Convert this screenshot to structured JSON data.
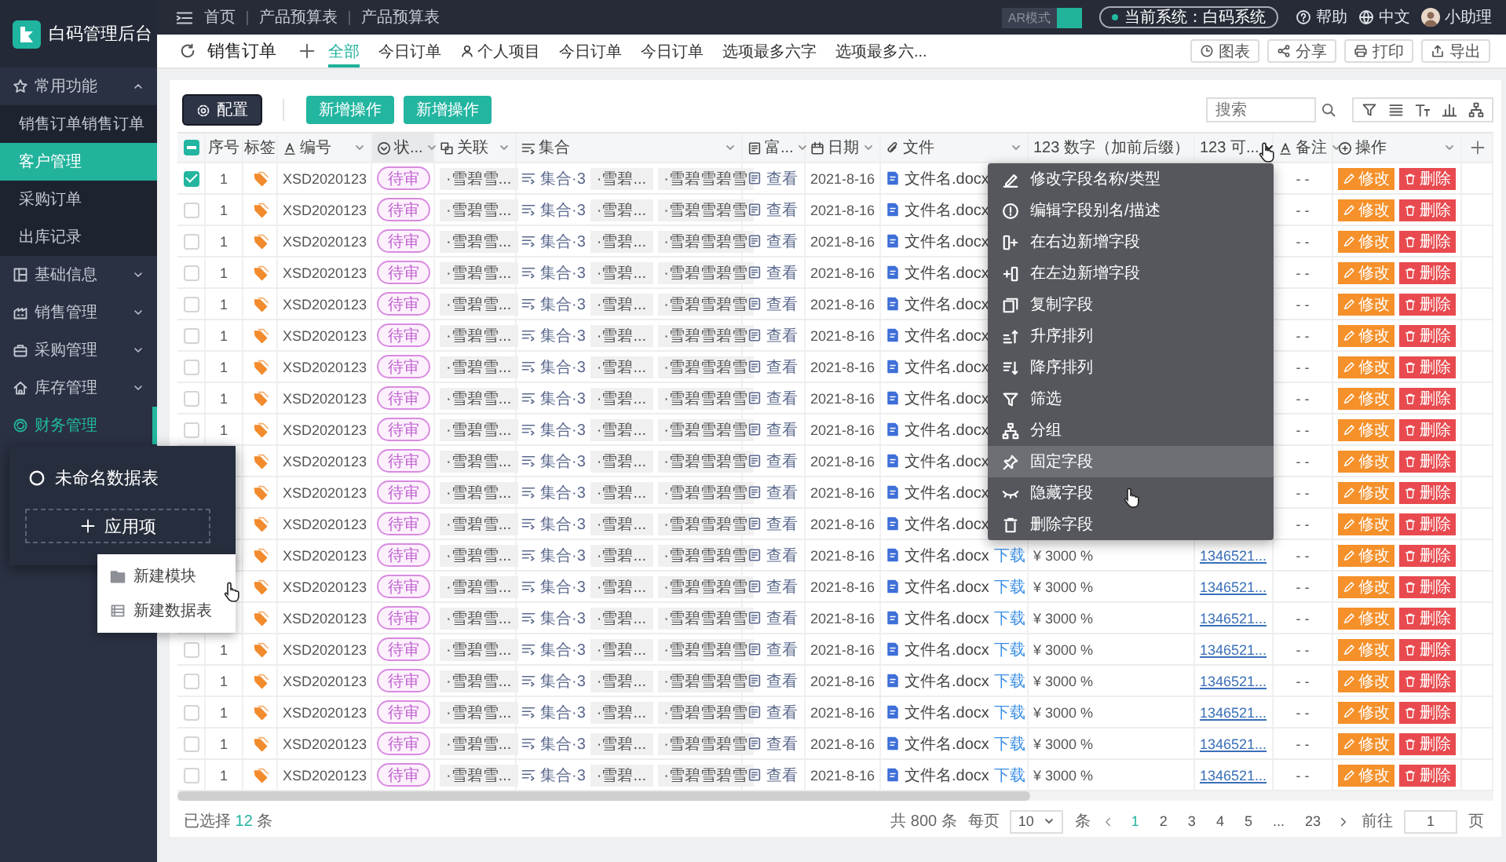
{
  "app": {
    "title": "白码管理后台"
  },
  "sidebar": {
    "items": [
      {
        "label": "常用功能",
        "selected": false,
        "expanded": true,
        "children": [
          {
            "label": "销售订单销售订单",
            "selected": false
          },
          {
            "label": "客户管理",
            "selected": true
          },
          {
            "label": "采购订单",
            "selected": false
          },
          {
            "label": "出库记录",
            "selected": false
          }
        ]
      },
      {
        "label": "基础信息",
        "selected": false,
        "expanded": false
      },
      {
        "label": "销售管理",
        "selected": false,
        "expanded": false
      },
      {
        "label": "采购管理",
        "selected": false,
        "expanded": false
      },
      {
        "label": "库存管理",
        "selected": false,
        "expanded": false
      },
      {
        "label": "财务管理",
        "selected": true
      }
    ]
  },
  "sidebar_popup": {
    "title": "未命名数据表",
    "add_button": "应用项",
    "menu": [
      {
        "label": "新建模块"
      },
      {
        "label": "新建数据表"
      }
    ]
  },
  "topbar": {
    "breadcrumbs": [
      "首页",
      "产品预算表",
      "产品预算表"
    ],
    "mode": {
      "label": "AR模式",
      "on": true
    },
    "system": "当前系统：白码系统",
    "help": "帮助",
    "language": "中文",
    "user": "小助理"
  },
  "page": {
    "title": "销售订单",
    "tabs": [
      {
        "label": "全部",
        "kind": "text",
        "selected": true
      },
      {
        "label": "今日订单",
        "kind": "text",
        "selected": false
      },
      {
        "label": "个人项目",
        "kind": "user",
        "selected": false
      },
      {
        "label": "今日订单",
        "kind": "text",
        "selected": false
      },
      {
        "label": "今日订单",
        "kind": "text",
        "selected": false
      },
      {
        "label": "选项最多六字",
        "kind": "text",
        "selected": false
      },
      {
        "label": "选项最多六...",
        "kind": "text",
        "selected": false
      }
    ],
    "actions": [
      "图表",
      "分享",
      "打印",
      "导出"
    ]
  },
  "toolbar": {
    "buttons": [
      {
        "label": "配置",
        "kind": "config"
      },
      {
        "label": "新增操作",
        "kind": "primary"
      },
      {
        "label": "新增操作",
        "kind": "primary"
      }
    ],
    "search": {
      "placeholder": "搜索"
    }
  },
  "table": {
    "select_all": {
      "indeterminate": true
    },
    "columns": [
      {
        "label": "序号",
        "kind": "seq",
        "highlighted": false
      },
      {
        "label": "标签",
        "kind": "tag",
        "highlighted": false
      },
      {
        "label": "编号",
        "kind": "code",
        "highlighted": false
      },
      {
        "label": "状...",
        "kind": "status",
        "highlighted": true
      },
      {
        "label": "关联",
        "kind": "link",
        "highlighted": false
      },
      {
        "label": "集合",
        "kind": "set",
        "highlighted": false
      },
      {
        "label": "富...",
        "kind": "rich",
        "highlighted": false
      },
      {
        "label": "日期",
        "kind": "date",
        "highlighted": false
      },
      {
        "label": "文件",
        "kind": "file",
        "highlighted": false
      },
      {
        "label": "123 数字（加前后缀）",
        "kind": "number",
        "highlighted": false
      },
      {
        "label": "123 可...",
        "kind": "number2",
        "highlighted": false
      },
      {
        "label": "备注",
        "kind": "note",
        "highlighted": false
      },
      {
        "label": "操作",
        "kind": "ops",
        "highlighted": false
      }
    ],
    "rows": [
      {
        "checked": true,
        "seq": "1",
        "code": "XSD2020123",
        "status": "待审",
        "link": "·雪碧雪...",
        "set": "集合·3",
        "set_items": [
          "·雪碧...",
          "·雪碧雪碧雪"
        ],
        "rich": "查看",
        "date": "2021-8-16",
        "file": "文件名.docx",
        "note": "- -",
        "actions": [
          {
            "label": "修改",
            "kind": "edit"
          },
          {
            "label": "删除",
            "kind": "delete"
          }
        ]
      },
      {
        "checked": false,
        "seq": "1",
        "code": "XSD2020123",
        "status": "待审",
        "link": "·雪碧雪...",
        "set": "集合·3",
        "set_items": [
          "·雪碧...",
          "·雪碧雪碧雪"
        ],
        "rich": "查看",
        "date": "2021-8-16",
        "file": "文件名.docx",
        "note": "- -",
        "actions": [
          {
            "label": "修改",
            "kind": "edit"
          },
          {
            "label": "删除",
            "kind": "delete"
          }
        ]
      },
      {
        "checked": false,
        "seq": "1",
        "code": "XSD2020123",
        "status": "待审",
        "link": "·雪碧雪...",
        "set": "集合·3",
        "set_items": [
          "·雪碧...",
          "·雪碧雪碧雪"
        ],
        "rich": "查看",
        "date": "2021-8-16",
        "file": "文件名.docx",
        "note": "- -",
        "actions": [
          {
            "label": "修改",
            "kind": "edit"
          },
          {
            "label": "删除",
            "kind": "delete"
          }
        ]
      },
      {
        "checked": false,
        "seq": "1",
        "code": "XSD2020123",
        "status": "待审",
        "link": "·雪碧雪...",
        "set": "集合·3",
        "set_items": [
          "·雪碧...",
          "·雪碧雪碧雪"
        ],
        "rich": "查看",
        "date": "2021-8-16",
        "file": "文件名.docx",
        "note": "- -",
        "actions": [
          {
            "label": "修改",
            "kind": "edit"
          },
          {
            "label": "删除",
            "kind": "delete"
          }
        ]
      },
      {
        "checked": false,
        "seq": "1",
        "code": "XSD2020123",
        "status": "待审",
        "link": "·雪碧雪...",
        "set": "集合·3",
        "set_items": [
          "·雪碧...",
          "·雪碧雪碧雪"
        ],
        "rich": "查看",
        "date": "2021-8-16",
        "file": "文件名.docx",
        "note": "- -",
        "actions": [
          {
            "label": "修改",
            "kind": "edit"
          },
          {
            "label": "删除",
            "kind": "delete"
          }
        ]
      },
      {
        "checked": false,
        "seq": "1",
        "code": "XSD2020123",
        "status": "待审",
        "link": "·雪碧雪...",
        "set": "集合·3",
        "set_items": [
          "·雪碧...",
          "·雪碧雪碧雪"
        ],
        "rich": "查看",
        "date": "2021-8-16",
        "file": "文件名.docx",
        "note": "- -",
        "actions": [
          {
            "label": "修改",
            "kind": "edit"
          },
          {
            "label": "删除",
            "kind": "delete"
          }
        ]
      },
      {
        "checked": false,
        "seq": "1",
        "code": "XSD2020123",
        "status": "待审",
        "link": "·雪碧雪...",
        "set": "集合·3",
        "set_items": [
          "·雪碧...",
          "·雪碧雪碧雪"
        ],
        "rich": "查看",
        "date": "2021-8-16",
        "file": "文件名.docx",
        "note": "- -",
        "actions": [
          {
            "label": "修改",
            "kind": "edit"
          },
          {
            "label": "删除",
            "kind": "delete"
          }
        ]
      },
      {
        "checked": false,
        "seq": "1",
        "code": "XSD2020123",
        "status": "待审",
        "link": "·雪碧雪...",
        "set": "集合·3",
        "set_items": [
          "·雪碧...",
          "·雪碧雪碧雪"
        ],
        "rich": "查看",
        "date": "2021-8-16",
        "file": "文件名.docx",
        "note": "- -",
        "actions": [
          {
            "label": "修改",
            "kind": "edit"
          },
          {
            "label": "删除",
            "kind": "delete"
          }
        ]
      },
      {
        "checked": false,
        "seq": "1",
        "code": "XSD2020123",
        "status": "待审",
        "link": "·雪碧雪...",
        "set": "集合·3",
        "set_items": [
          "·雪碧...",
          "·雪碧雪碧雪"
        ],
        "rich": "查看",
        "date": "2021-8-16",
        "file": "文件名.docx",
        "note": "- -",
        "actions": [
          {
            "label": "修改",
            "kind": "edit"
          },
          {
            "label": "删除",
            "kind": "delete"
          }
        ]
      },
      {
        "code": "XSD2020123",
        "status": "待审",
        "link": "·雪碧雪...",
        "set": "集合·3",
        "set_items": [
          "·雪碧...",
          "·雪碧雪碧雪"
        ],
        "rich": "查看",
        "date": "2021-8-16",
        "file": "文件名.docx",
        "note": "- -",
        "actions": [
          {
            "label": "修改",
            "kind": "edit"
          },
          {
            "label": "删除",
            "kind": "delete"
          }
        ]
      },
      {
        "code": "XSD2020123",
        "status": "待审",
        "link": "·雪碧雪...",
        "set": "集合·3",
        "set_items": [
          "·雪碧...",
          "·雪碧雪碧雪"
        ],
        "rich": "查看",
        "date": "2021-8-16",
        "file": "文件名.docx",
        "note": "- -",
        "actions": [
          {
            "label": "修改",
            "kind": "edit"
          },
          {
            "label": "删除",
            "kind": "delete"
          }
        ]
      },
      {
        "code": "XSD2020123",
        "status": "待审",
        "link": "·雪碧雪...",
        "set": "集合·3",
        "set_items": [
          "·雪碧...",
          "·雪碧雪碧雪"
        ],
        "rich": "查看",
        "date": "2021-8-16",
        "file": "文件名.docx",
        "note": "- -",
        "actions": [
          {
            "label": "修改",
            "kind": "edit"
          },
          {
            "label": "删除",
            "kind": "delete"
          }
        ]
      },
      {
        "code": "XSD2020123",
        "status": "待审",
        "link": "·雪碧雪...",
        "set": "集合·3",
        "set_items": [
          "·雪碧...",
          "·雪碧雪碧雪"
        ],
        "rich": "查看",
        "date": "2021-8-16",
        "file": "文件名.docx",
        "download": "下载",
        "amount": "¥ 3000 %",
        "phone": "1346521...",
        "note": "- -",
        "actions": [
          {
            "label": "修改",
            "kind": "edit"
          },
          {
            "label": "删除",
            "kind": "delete"
          }
        ]
      },
      {
        "code": "XSD2020123",
        "status": "待审",
        "link": "·雪碧雪...",
        "set": "集合·3",
        "set_items": [
          "·雪碧...",
          "·雪碧雪碧雪"
        ],
        "rich": "查看",
        "date": "2021-8-16",
        "file": "文件名.docx",
        "download": "下载",
        "amount": "¥ 3000 %",
        "phone": "1346521...",
        "note": "- -",
        "actions": [
          {
            "label": "修改",
            "kind": "edit"
          },
          {
            "label": "删除",
            "kind": "delete"
          }
        ]
      },
      {
        "code": "XSD2020123",
        "status": "待审",
        "link": "·雪碧雪...",
        "set": "集合·3",
        "set_items": [
          "·雪碧...",
          "·雪碧雪碧雪"
        ],
        "rich": "查看",
        "date": "2021-8-16",
        "file": "文件名.docx",
        "download": "下载",
        "amount": "¥ 3000 %",
        "phone": "1346521...",
        "note": "- -",
        "actions": [
          {
            "label": "修改",
            "kind": "edit"
          },
          {
            "label": "删除",
            "kind": "delete"
          }
        ]
      },
      {
        "checked": false,
        "seq": "1",
        "code": "XSD2020123",
        "status": "待审",
        "link": "·雪碧雪...",
        "set": "集合·3",
        "set_items": [
          "·雪碧...",
          "·雪碧雪碧雪"
        ],
        "rich": "查看",
        "date": "2021-8-16",
        "file": "文件名.docx",
        "download": "下载",
        "amount": "¥ 3000 %",
        "phone": "1346521...",
        "note": "- -",
        "actions": [
          {
            "label": "修改",
            "kind": "edit"
          },
          {
            "label": "删除",
            "kind": "delete"
          }
        ]
      },
      {
        "checked": false,
        "seq": "1",
        "code": "XSD2020123",
        "status": "待审",
        "link": "·雪碧雪...",
        "set": "集合·3",
        "set_items": [
          "·雪碧...",
          "·雪碧雪碧雪"
        ],
        "rich": "查看",
        "date": "2021-8-16",
        "file": "文件名.docx",
        "download": "下载",
        "amount": "¥ 3000 %",
        "phone": "1346521...",
        "note": "- -",
        "actions": [
          {
            "label": "修改",
            "kind": "edit"
          },
          {
            "label": "删除",
            "kind": "delete"
          }
        ]
      },
      {
        "checked": false,
        "seq": "1",
        "code": "XSD2020123",
        "status": "待审",
        "link": "·雪碧雪...",
        "set": "集合·3",
        "set_items": [
          "·雪碧...",
          "·雪碧雪碧雪"
        ],
        "rich": "查看",
        "date": "2021-8-16",
        "file": "文件名.docx",
        "download": "下载",
        "amount": "¥ 3000 %",
        "phone": "1346521...",
        "note": "- -",
        "actions": [
          {
            "label": "修改",
            "kind": "edit"
          },
          {
            "label": "删除",
            "kind": "delete"
          }
        ]
      },
      {
        "checked": false,
        "seq": "1",
        "code": "XSD2020123",
        "status": "待审",
        "link": "·雪碧雪...",
        "set": "集合·3",
        "set_items": [
          "·雪碧...",
          "·雪碧雪碧雪"
        ],
        "rich": "查看",
        "date": "2021-8-16",
        "file": "文件名.docx",
        "download": "下载",
        "amount": "¥ 3000 %",
        "phone": "1346521...",
        "note": "- -",
        "actions": [
          {
            "label": "修改",
            "kind": "edit"
          },
          {
            "label": "删除",
            "kind": "delete"
          }
        ]
      },
      {
        "checked": false,
        "seq": "1",
        "code": "XSD2020123",
        "status": "待审",
        "link": "·雪碧雪...",
        "set": "集合·3",
        "set_items": [
          "·雪碧...",
          "·雪碧雪碧雪"
        ],
        "rich": "查看",
        "date": "2021-8-16",
        "file": "文件名.docx",
        "download": "下载",
        "amount": "¥ 3000 %",
        "phone": "1346521...",
        "note": "- -",
        "actions": [
          {
            "label": "修改",
            "kind": "edit"
          },
          {
            "label": "删除",
            "kind": "delete"
          }
        ]
      }
    ]
  },
  "context_menu": {
    "items": [
      {
        "label": "修改字段名称/类型",
        "selected": false
      },
      {
        "label": "编辑字段别名/描述",
        "selected": false
      },
      {
        "label": "在右边新增字段",
        "selected": false
      },
      {
        "label": "在左边新增字段",
        "selected": false
      },
      {
        "label": "复制字段",
        "selected": false
      },
      {
        "label": "升序排列",
        "selected": false
      },
      {
        "label": "降序排列",
        "selected": false
      },
      {
        "label": "筛选",
        "selected": false
      },
      {
        "label": "分组",
        "selected": false
      },
      {
        "label": "固定字段",
        "selected": true
      },
      {
        "label": "隐藏字段",
        "selected": false
      },
      {
        "label": "删除字段",
        "selected": false
      }
    ]
  },
  "footer": {
    "selection": {
      "prefix": "已选择",
      "count": "12",
      "suffix": "条"
    }
  },
  "pager": {
    "total": "共 800 条",
    "per_page_label": "每页",
    "page_size": "10",
    "unit": "条",
    "pages": [
      {
        "label": "1",
        "selected": true
      },
      {
        "label": "2",
        "selected": false
      },
      {
        "label": "3",
        "selected": false
      },
      {
        "label": "4",
        "selected": false
      },
      {
        "label": "5",
        "selected": false
      },
      {
        "label": "...",
        "selected": false
      },
      {
        "label": "23",
        "selected": false
      }
    ],
    "goto_label": "前往",
    "goto_value": "1",
    "goto_suffix": "页"
  }
}
